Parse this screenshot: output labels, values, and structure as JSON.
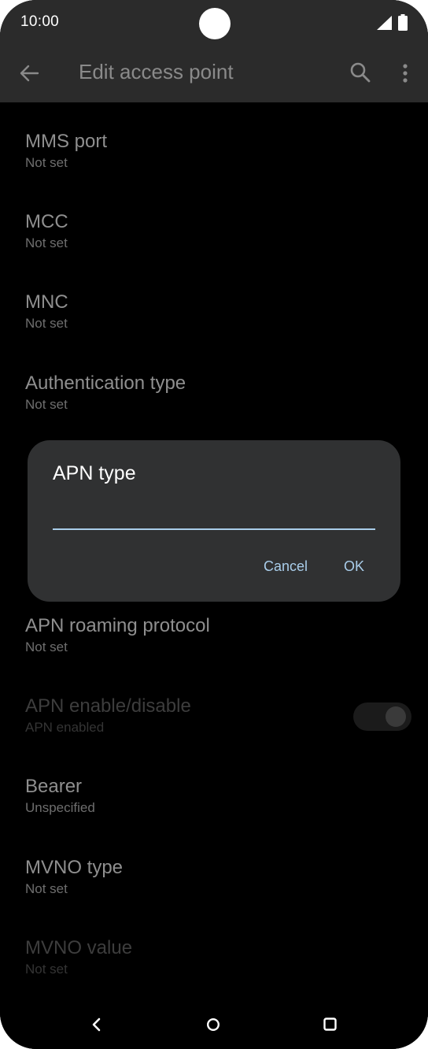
{
  "status_bar": {
    "time": "10:00",
    "icons": [
      "signal-icon",
      "battery-icon"
    ]
  },
  "app_bar": {
    "title": "Edit access point",
    "icons": [
      "back-arrow-icon",
      "search-icon",
      "more-vert-icon"
    ]
  },
  "preferences": [
    {
      "title": "MMS port",
      "summary": "Not set"
    },
    {
      "title": "MCC",
      "summary": "Not set"
    },
    {
      "title": "MNC",
      "summary": "Not set"
    },
    {
      "title": "Authentication type",
      "summary": "Not set"
    },
    {
      "title": "APN roaming protocol",
      "summary": "Not set"
    },
    {
      "title": "APN enable/disable",
      "summary": "APN enabled",
      "toggle_on": true,
      "disabled": true
    },
    {
      "title": "Bearer",
      "summary": "Unspecified"
    },
    {
      "title": "MVNO type",
      "summary": "Not set"
    },
    {
      "title": "MVNO value",
      "summary": "Not set",
      "disabled": true
    }
  ],
  "dialog": {
    "title": "APN type",
    "input_value": "",
    "cancel_label": "Cancel",
    "ok_label": "OK"
  },
  "nav_bar": {
    "icons": [
      "nav-back-icon",
      "nav-home-icon",
      "nav-recents-icon"
    ]
  },
  "colors": {
    "accent": "#a9cdea",
    "dialog_bg": "#303132",
    "bar_bg": "#2b2b2b"
  }
}
